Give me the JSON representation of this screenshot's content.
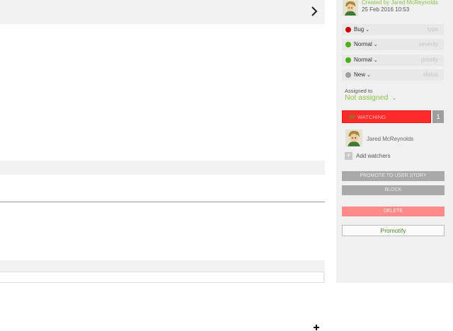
{
  "issue": {
    "created_by": "Created by Jared McReynolds",
    "created_date": "25 Feb 2016 10:53"
  },
  "fields": {
    "type": {
      "value": "Bug",
      "label": "type",
      "color": "#cc0000"
    },
    "severity": {
      "value": "Normal",
      "label": "severity",
      "color": "#4caf1a"
    },
    "priority": {
      "value": "Normal",
      "label": "priority",
      "color": "#4caf1a"
    },
    "status": {
      "value": "New",
      "label": "status",
      "color": "#9e9e9e"
    }
  },
  "assignment": {
    "label": "Assigned to",
    "value": "Not assigned"
  },
  "watching": {
    "label": "WATCHING",
    "count": "1",
    "icon": "eye-icon"
  },
  "watchers": [
    {
      "name": "Jared McReynolds"
    }
  ],
  "add_watchers_label": "Add watchers",
  "actions": {
    "promote": "PROMOTE TO USER STORY",
    "block": "BLOCK",
    "delete": "DELETE",
    "promotify": "Promotify"
  },
  "icons": {
    "expand": "chevron-right-icon",
    "add": "plus-icon"
  },
  "colors": {
    "accent_green": "#8bc34a",
    "watching_red": "#ff2a2a",
    "delete_pink": "#ff8a8a",
    "neutral_grey": "#a9a9a9"
  }
}
